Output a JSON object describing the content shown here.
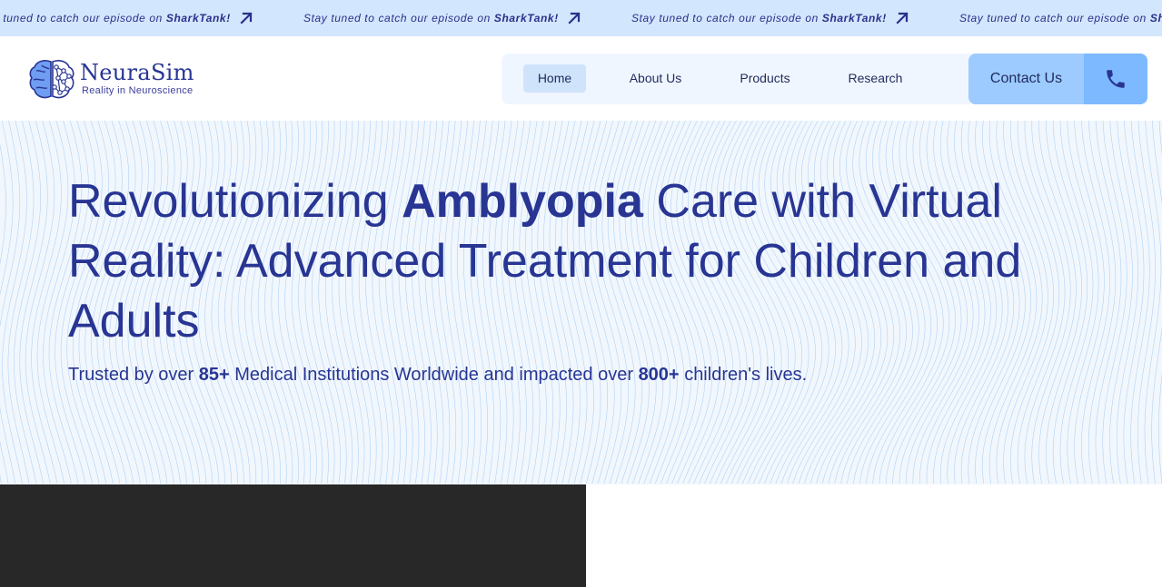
{
  "ticker": {
    "items": [
      {
        "lead": "Stay tuned to catch our episode on",
        "brand": "SharkTank!",
        "icon": "arrow-up-right-icon"
      },
      {
        "lead": "Stay tuned to catch our episode on",
        "brand": "SharkTank!",
        "icon": "arrow-up-right-icon"
      },
      {
        "lead": "Stay tuned to catch our episode on",
        "brand": "SharkTank!",
        "icon": "arrow-up-right-icon"
      },
      {
        "lead": "Stay tuned to catch our episode on",
        "brand": "SharkTank!",
        "icon": "arrow-up-right-icon"
      }
    ],
    "colors": {
      "background": "#d2e6fd",
      "text": "#2b2f8a"
    }
  },
  "header": {
    "logo": {
      "name": "NeuraSim",
      "tagline": "Reality in Neuroscience",
      "icon": "brain-network-icon"
    },
    "nav": {
      "items": [
        {
          "label": "Home",
          "active": true
        },
        {
          "label": "About Us",
          "active": false
        },
        {
          "label": "Products",
          "active": false
        },
        {
          "label": "Research",
          "active": false
        }
      ]
    },
    "contact": {
      "label": "Contact Us",
      "icon": "phone-icon"
    }
  },
  "hero": {
    "title_prefix": "Revolutionizing",
    "title_highlight": "Amblyopia",
    "title_suffix": "Care with Virtual Reality: Advanced Treatment for Children and Adults",
    "sub_part1": "Trusted by over",
    "sub_stat1": "85+",
    "sub_part2": "Medical Institutions Worldwide and impacted over",
    "sub_stat2": "800+",
    "sub_part3": "children's lives.",
    "background_pattern": "wavy-lines"
  },
  "colors": {
    "primary": "#283593",
    "accent_light": "#9dcbff",
    "accent": "#7db9ff",
    "hero_bg": "#f1f7fd",
    "dark_panel": "#282828"
  }
}
